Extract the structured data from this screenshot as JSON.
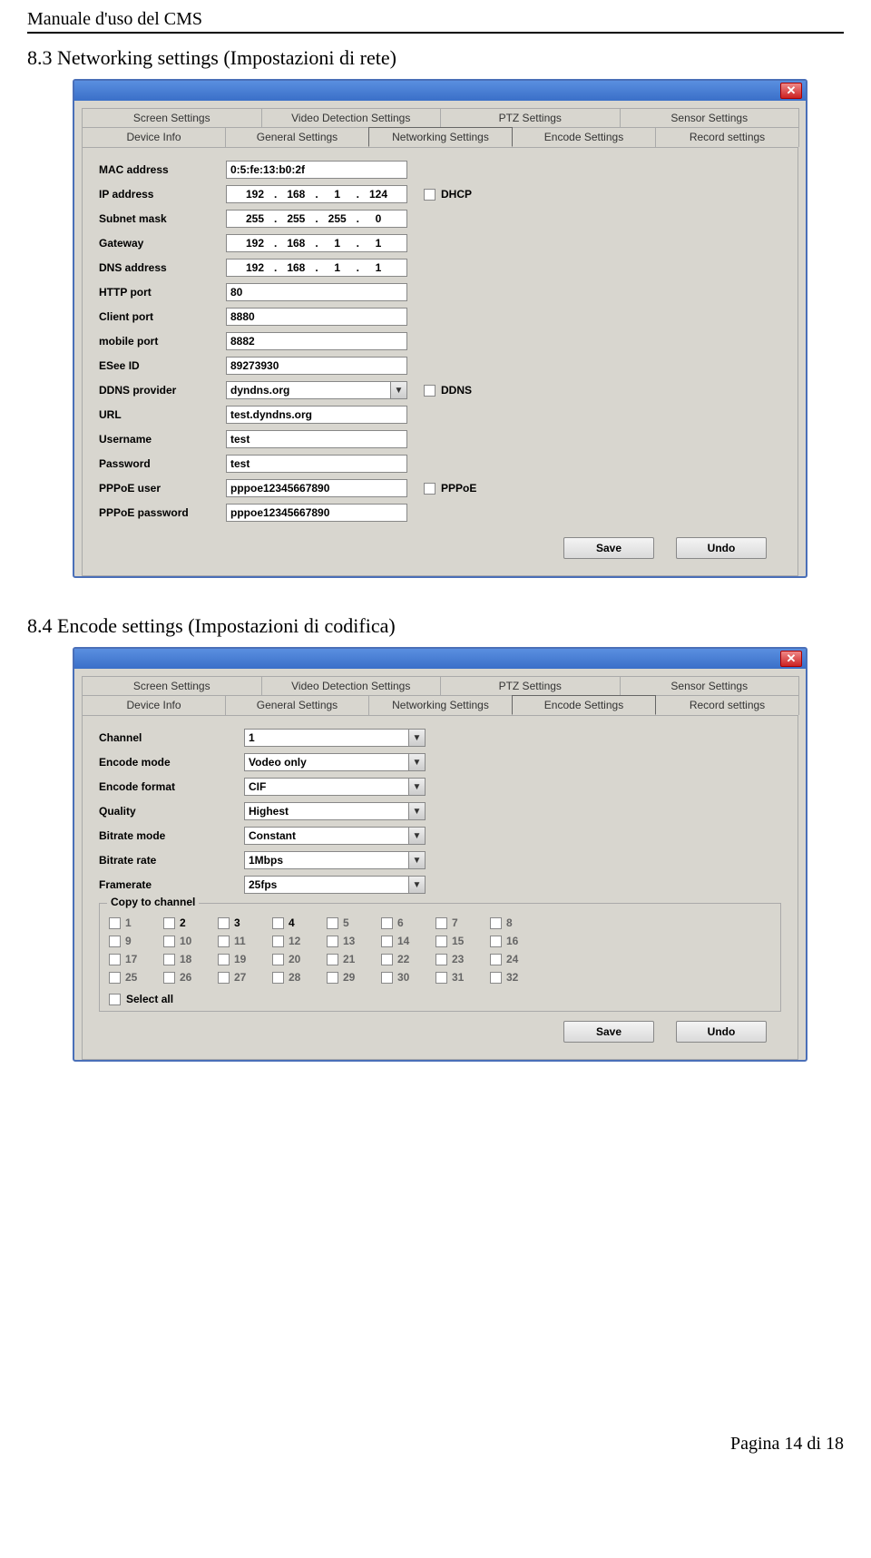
{
  "doc": {
    "header": "Manuale d'uso del CMS",
    "section1": "8.3 Networking settings (Impostazioni di rete)",
    "section2": "8.4 Encode settings (Impostazioni di codifica)",
    "footer": "Pagina 14 di 18"
  },
  "tabs_row1": [
    "Screen Settings",
    "Video Detection Settings",
    "PTZ Settings",
    "Sensor Settings"
  ],
  "tabs_row2": [
    "Device Info",
    "General Settings",
    "Networking Settings",
    "Encode Settings",
    "Record settings"
  ],
  "win1": {
    "active_tab": "Networking Settings",
    "fields": {
      "mac_label": "MAC address",
      "mac_value": "0:5:fe:13:b0:2f",
      "ip_label": "IP address",
      "ip_value": [
        "192",
        "168",
        "1",
        "124"
      ],
      "dhcp_label": "DHCP",
      "subnet_label": "Subnet mask",
      "subnet_value": [
        "255",
        "255",
        "255",
        "0"
      ],
      "gateway_label": "Gateway",
      "gateway_value": [
        "192",
        "168",
        "1",
        "1"
      ],
      "dns_label": "DNS address",
      "dns_value": [
        "192",
        "168",
        "1",
        "1"
      ],
      "http_label": "HTTP port",
      "http_value": "80",
      "client_label": "Client port",
      "client_value": "8880",
      "mobile_label": "mobile port",
      "mobile_value": "8882",
      "esee_label": "ESee ID",
      "esee_value": "89273930",
      "ddnsprov_label": "DDNS provider",
      "ddnsprov_value": "dyndns.org",
      "ddns_label": "DDNS",
      "url_label": "URL",
      "url_value": "test.dyndns.org",
      "user_label": "Username",
      "user_value": "test",
      "pass_label": "Password",
      "pass_value": "test",
      "pppoe_user_label": "PPPoE user",
      "pppoe_user_value": "pppoe12345667890",
      "pppoe_label": "PPPoE",
      "pppoe_pass_label": "PPPoE password",
      "pppoe_pass_value": "pppoe12345667890"
    },
    "save": "Save",
    "undo": "Undo"
  },
  "win2": {
    "active_tab": "Encode Settings",
    "fields": {
      "channel_label": "Channel",
      "channel_value": "1",
      "encmode_label": "Encode mode",
      "encmode_value": "Vodeo only",
      "encfmt_label": "Encode format",
      "encfmt_value": "CIF",
      "quality_label": "Quality",
      "quality_value": "Highest",
      "brmode_label": "Bitrate mode",
      "brmode_value": "Constant",
      "brrate_label": "Bitrate rate",
      "brrate_value": "1Mbps",
      "framerate_label": "Framerate",
      "framerate_value": "25fps"
    },
    "copy_group": "Copy to channel",
    "channels": [
      1,
      2,
      3,
      4,
      5,
      6,
      7,
      8,
      9,
      10,
      11,
      12,
      13,
      14,
      15,
      16,
      17,
      18,
      19,
      20,
      21,
      22,
      23,
      24,
      25,
      26,
      27,
      28,
      29,
      30,
      31,
      32
    ],
    "channels_enabled": [
      2,
      3,
      4
    ],
    "select_all": "Select all",
    "save": "Save",
    "undo": "Undo"
  }
}
